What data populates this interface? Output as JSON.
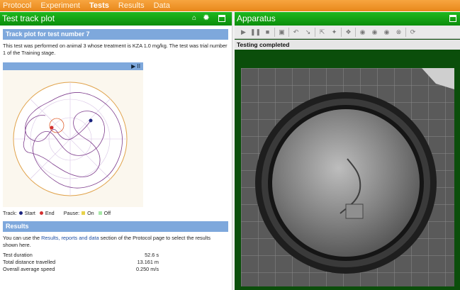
{
  "menu": {
    "items": [
      {
        "label": "Protocol"
      },
      {
        "label": "Experiment"
      },
      {
        "label": "Tests"
      },
      {
        "label": "Results"
      },
      {
        "label": "Data"
      }
    ],
    "active": "Tests"
  },
  "left_panel": {
    "title": "Test track plot",
    "section_title": "Track plot for test number 7",
    "description": "This test was performed on animal 3 whose treatment is KZA 1.0 mg/kg.  The test was trial number 1 of the Training stage.",
    "plot_controls": "▶ II",
    "legend": {
      "track_label": "Track:",
      "start_label": "Start",
      "end_label": "End",
      "pause_label": "Pause:",
      "on_label": "On",
      "off_label": "Off",
      "start_color": "#1a237e",
      "end_color": "#d32f2f",
      "on_color": "#e8d24a",
      "off_color": "#a7e8a7"
    },
    "results": {
      "title": "Results",
      "text_before": "You can use the ",
      "link": "Results, reports and data",
      "text_after": " section of the Protocol page to select the results shown here.",
      "stats": [
        {
          "label": "Test duration",
          "value": "52.6 s"
        },
        {
          "label": "Total distance travelled",
          "value": "13.161 m"
        },
        {
          "label": "Overall average speed",
          "value": "0.250 m/s"
        }
      ]
    }
  },
  "right_panel": {
    "title": "Apparatus",
    "status": "Testing completed"
  },
  "colors": {
    "menu_orange": "#e8881a",
    "header_green": "#0b8d0b",
    "section_blue": "#7ea8dc",
    "track_purple": "#7d3c8c"
  }
}
